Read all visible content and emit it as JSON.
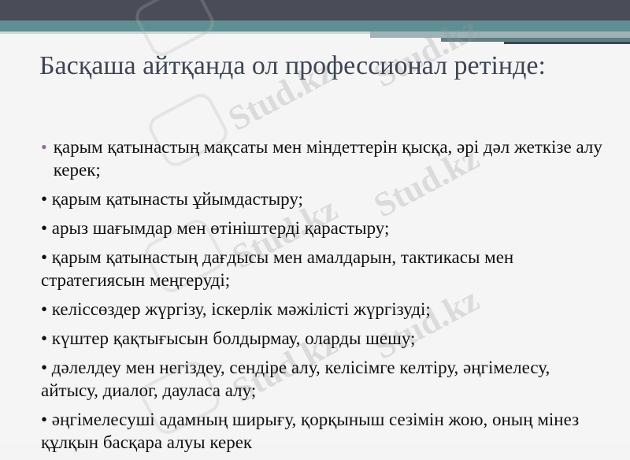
{
  "slide": {
    "title": "Басқаша  айтқанда ол профессионал ретінде:",
    "bullets": [
      "қарым қатынастың мақсаты мен міндеттерін қысқа, әрі дәл жеткізе алу керек;",
      "• қарым қатынасты ұйымдастыру;",
      "• арыз шағымдар мен өтініштерді қарастыру;",
      "• қарым қатынастың дағдысы мен амалдарын, тактикасы мен стратегиясын меңгеруді;",
      "• келіссөздер жүргізу, іскерлік мәжілісті жүргізуді;",
      "• күштер қақтығысын болдырмау, оларды шешу;",
      "• дәлелдеу мен негіздеу, сендіре алу, келісімге келтіру, әңгімелесу, айтысу, диалог, дауласа алу;",
      "• әңгімелесуші адамның ширығу, қорқыныш сезімін жою, оның мінез құлқын басқара алуы керек"
    ],
    "first_bullet_glyph": "•",
    "watermark_text": "Stud.kz"
  },
  "colors": {
    "band_dark": "#4a4c58",
    "band_teal": "#5f8f92",
    "title": "#3e4553",
    "bullet_accent": "#8a6ca2"
  }
}
